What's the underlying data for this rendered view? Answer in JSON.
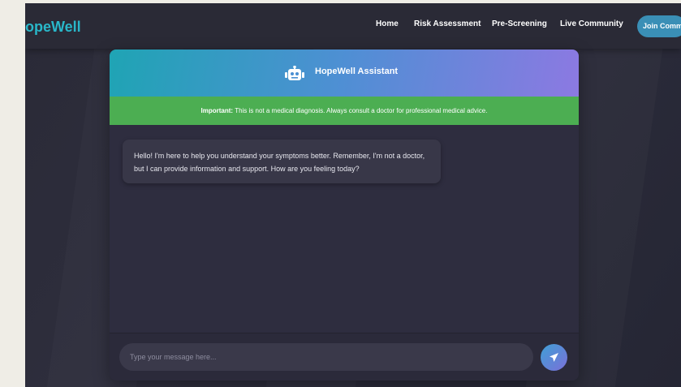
{
  "nav": {
    "logo": "HopeWell",
    "links": [
      "Home",
      "Risk Assessment",
      "Pre-Screening",
      "Live Community"
    ],
    "join_label": "Join Community"
  },
  "chat": {
    "title": "HopeWell Assistant",
    "header_icon": "robot-icon",
    "disclaimer_bold": "Important:",
    "disclaimer_text": " This is not a medical diagnosis. Always consult a doctor for professional medical advice.",
    "messages": [
      {
        "sender": "assistant",
        "text": "Hello! I'm here to help you understand your symptoms better. Remember, I'm not a doctor, but I can provide information and support. How are you feeling today?"
      }
    ],
    "input_placeholder": "Type your message here...",
    "send_icon": "send-icon"
  },
  "colors": {
    "logo": "#29b7c9",
    "disclaimer_bg": "#4cae52",
    "header_gradient_start": "#1fa4b4",
    "header_gradient_end": "#8c79e2"
  }
}
